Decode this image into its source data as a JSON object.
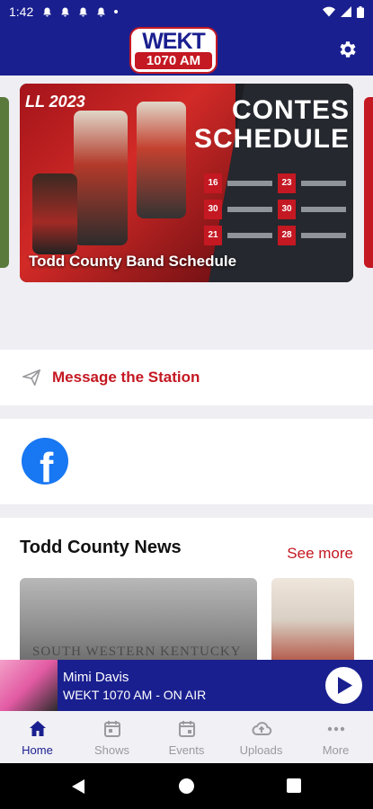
{
  "status_bar": {
    "time": "1:42"
  },
  "header": {
    "logo_top": "WEKT",
    "logo_bottom": "1070 AM"
  },
  "featured": {
    "banner_year": "LL 2023",
    "banner_title_1": "CONTES",
    "banner_title_2": "SCHEDULE",
    "rows": [
      "16",
      "23",
      "30",
      "30",
      "21",
      "28"
    ],
    "caption": "Todd County Band Schedule"
  },
  "message": {
    "label": "Message the Station"
  },
  "news": {
    "title": "Todd County News",
    "see_more": "See more",
    "image_caption": "SOUTH WESTERN KENTUCKY"
  },
  "player": {
    "name": "Mimi Davis",
    "station": "WEKT 1070 AM - ON AIR"
  },
  "nav": {
    "home": "Home",
    "shows": "Shows",
    "events": "Events",
    "uploads": "Uploads",
    "more": "More"
  },
  "colors": {
    "brand_blue": "#1a1f8f",
    "brand_red": "#c41822",
    "facebook": "#1877f2"
  }
}
